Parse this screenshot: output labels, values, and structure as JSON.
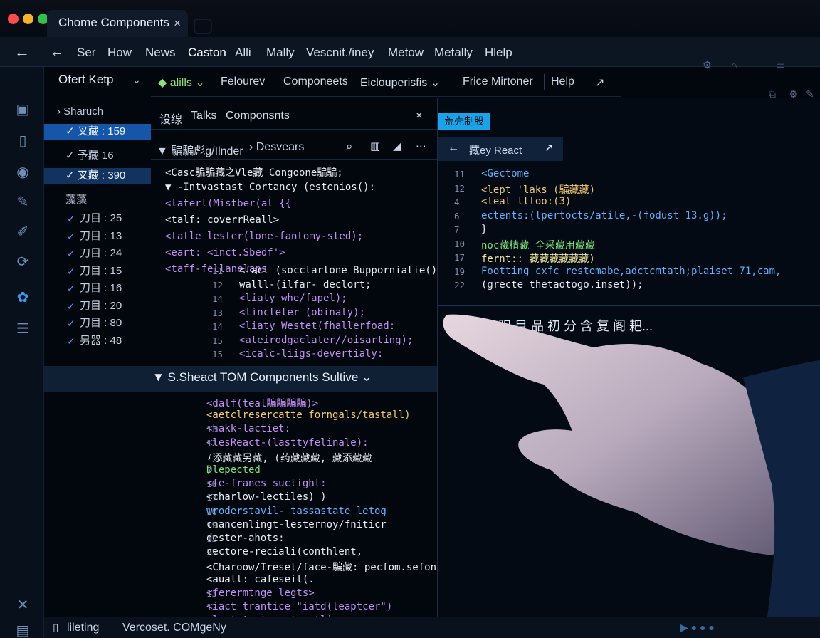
{
  "window": {
    "tab_title": "Chome Components",
    "close_glyph": "×"
  },
  "menubar": {
    "items": [
      "Ser",
      "How",
      "News",
      "Caston",
      "Alli",
      "Mally",
      "Vescnit./iney",
      "Metow",
      "Metally",
      "Hlelp"
    ],
    "active": "Caston"
  },
  "explorer": {
    "header": "Ofert  Ketp",
    "search_label": "Sharuch",
    "groups": [
      {
        "label": "✓ 叉藏 : 159",
        "state": "selected"
      },
      {
        "label": "✓ 予藏 16",
        "state": "normal"
      },
      {
        "label": "✓ 叉藏 : 390",
        "state": "highlight"
      }
    ],
    "section_label": "藻藻",
    "checked_items": [
      {
        "label": "刀目 : 25"
      },
      {
        "label": "刀目 : 13"
      },
      {
        "label": "刀目 : 24"
      },
      {
        "label": "刀目 : 15"
      },
      {
        "label": "刀目 : 16"
      },
      {
        "label": "刀目 : 20"
      },
      {
        "label": "刀目 : 80"
      },
      {
        "label": "另器 : 48"
      }
    ]
  },
  "toolbar2": {
    "items": [
      "◆ alills ⌄",
      "Felourev",
      "Componeets",
      "Eiclouperisfis ⌄",
      "Frice Mirtoner",
      "Help",
      "↗"
    ]
  },
  "editor_tabs": {
    "tabs": [
      "设缐",
      "Talks",
      "Componsnts"
    ],
    "close": "×"
  },
  "breadcrumb": {
    "path": "▼ 騙騙彪g/Ilnder",
    "next": "› Desvears"
  },
  "code_top": [
    {
      "text": "<Casc騙騙藏之Vle藏 Congoone騙騙;",
      "color": "c-t"
    },
    {
      "text": "▼ -Intvastast Cortancy (estenios():",
      "color": "c-t"
    },
    {
      "text": "<laterl(Mistber(al {{",
      "color": "c-p"
    },
    {
      "text": "<talf: coverrReall>",
      "color": "c-t"
    },
    {
      "text": "<tatle lester(lone-fantomy-sted);",
      "color": "c-p"
    },
    {
      "text": "<eart: <inct.Sbedf'>",
      "color": "c-p"
    },
    {
      "text": "<taff-fellanelaps",
      "color": "c-p"
    }
  ],
  "code_numbered": [
    {
      "n": "11",
      "text": "<fact (socctarlone Bupporniatie() =ol",
      "color": "c-t"
    },
    {
      "n": "12",
      "text": "walll-(ilfar- declort;",
      "color": "c-t"
    },
    {
      "n": "14",
      "text": "<liaty whe/fapel);",
      "color": "c-p"
    },
    {
      "n": "13",
      "text": "<lincteter (obinaly);",
      "color": "c-p"
    },
    {
      "n": "14",
      "text": "<liaty Westet(fhallerfoad:",
      "color": "c-p"
    },
    {
      "n": "15",
      "text": "<ateirodgaclater//oisarting);",
      "color": "c-p"
    },
    {
      "n": "15",
      "text": "<icalc-liigs-devertialy:",
      "color": "c-p"
    }
  ],
  "section": {
    "title": "▼  S.Sheact TOM Components Sultive  ⌄"
  },
  "code_bottom": [
    {
      "n": "",
      "text": "<dalf(teal騙騙騙騙)>",
      "color": "c-p"
    },
    {
      "n": "",
      "text": "<aetclresercatte forngals/tastall)",
      "color": "c-o"
    },
    {
      "n": "13",
      "text": "<hakk-lactiet:",
      "color": "c-p"
    },
    {
      "n": "12",
      "text": "<lesReact-(lasttyfelinale):",
      "color": "c-p"
    },
    {
      "n": "7",
      "text": "·添藏藏另藏, (药藏藏藏, 藏添藏藏",
      "color": "c-t"
    },
    {
      "n": "7",
      "text": "Dlepected",
      "color": "c-g"
    },
    {
      "n": "10",
      "text": "<fe-franes suctight:",
      "color": "c-p"
    },
    {
      "n": "17",
      "text": "<charlow-lectiles) )",
      "color": "c-t"
    },
    {
      "n": "10",
      "text": "wroderstavil- tassastate letog",
      "color": "c-b"
    },
    {
      "n": "19",
      "text": "cnancenlingt-lesternoy/fniticr",
      "color": "c-t"
    },
    {
      "n": "15",
      "text": "dester-ahots:",
      "color": "c-t"
    },
    {
      "n": "25",
      "text": "cectore-reciali(conthlent,",
      "color": "c-t"
    },
    {
      "n": "",
      "text": "<Charoow/Treset/face-騙藏: pecfom.sefonails",
      "color": "c-t"
    },
    {
      "n": "",
      "text": "<auall:  cafeseil(.",
      "color": "c-t"
    },
    {
      "n": "13",
      "text": "<ferermtnge legts>",
      "color": "c-p"
    },
    {
      "n": "12",
      "text": "<iact trantice \"iatd(leaptcer\")",
      "color": "c-p"
    },
    {
      "n": "",
      "text": "<laat-taster-streatlie>",
      "color": "c-p"
    }
  ],
  "right_pane": {
    "badge": "荒壳制股",
    "tab_label": "藏ey React",
    "code": [
      {
        "n": "11",
        "text": "<Gectome",
        "color": "c-b"
      },
      {
        "n": "12",
        "text": "<lept 'laks (騙藏藏)",
        "color": "c-o"
      },
      {
        "n": "4",
        "text": "<leat lttoo:(3)",
        "color": "c-o"
      },
      {
        "n": "6",
        "text": "ectents:(lpertocts/atile,-(fodust 13.g));",
        "color": "c-b"
      },
      {
        "n": "7",
        "text": "}",
        "color": "c-t"
      },
      {
        "n": "10",
        "text": "noc藏精藏 全采藏用藏藏",
        "color": "c-g"
      },
      {
        "n": "17",
        "text": "fernt:: 藏藏藏藏藏藏)",
        "color": "c-y"
      },
      {
        "n": "19",
        "text": "Footting cxfc restemabe,adctcmtath;plaiset 71,cam,",
        "color": "c-b"
      },
      {
        "n": "22",
        "text": "(grecte thetaotogo.inset));",
        "color": "c-t"
      }
    ],
    "overlay_text": "阳 目 品 初 分 含 复 阁 耙..."
  },
  "statusbar": {
    "left": "lileting",
    "right": "Vercoset. COMgeNy"
  }
}
